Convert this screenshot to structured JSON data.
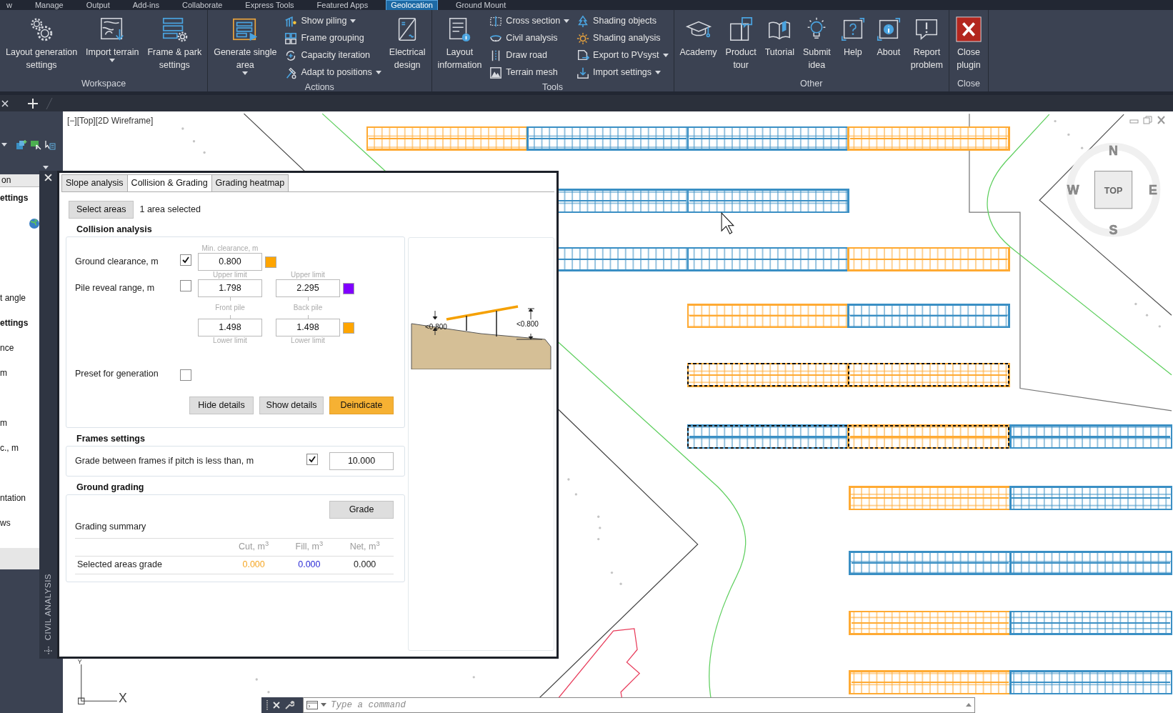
{
  "top_tabs": [
    {
      "label": "w",
      "selected": false
    },
    {
      "label": "Manage",
      "selected": false
    },
    {
      "label": "Output",
      "selected": false
    },
    {
      "label": "Add-ins",
      "selected": false
    },
    {
      "label": "Collaborate",
      "selected": false
    },
    {
      "label": "Express Tools",
      "selected": false
    },
    {
      "label": "Featured Apps",
      "selected": false
    },
    {
      "label": "Geolocation",
      "selected": true
    },
    {
      "label": "Ground Mount",
      "selected": false
    }
  ],
  "ribbon": {
    "panels": [
      {
        "title": "Workspace",
        "items": [
          {
            "kind": "large",
            "label": "Layout generation\nsettings",
            "dropdown": false
          },
          {
            "kind": "large",
            "label": "Import terrain",
            "dropdown": true
          },
          {
            "kind": "large",
            "label": "Frame & park\nsettings",
            "dropdown": false
          }
        ]
      },
      {
        "title": "Actions",
        "items": [
          {
            "kind": "large",
            "label": "Generate single\narea",
            "dropdown": true
          },
          {
            "kind": "stack",
            "entries": [
              {
                "label": "Show piling",
                "dropdown": true
              },
              {
                "label": "Frame grouping",
                "dropdown": false
              },
              {
                "label": "Capacity iteration",
                "dropdown": false
              },
              {
                "label": "Adapt to positions",
                "dropdown": true
              }
            ]
          },
          {
            "kind": "large",
            "label": "Electrical\ndesign",
            "dropdown": false
          }
        ]
      },
      {
        "title": "Tools",
        "items": [
          {
            "kind": "large",
            "label": "Layout\ninformation",
            "dropdown": false
          },
          {
            "kind": "stack",
            "entries": [
              {
                "label": "Cross section",
                "dropdown": true
              },
              {
                "label": "Civil analysis",
                "dropdown": false
              },
              {
                "label": "Draw road",
                "dropdown": false
              },
              {
                "label": "Terrain mesh",
                "dropdown": false
              }
            ]
          },
          {
            "kind": "stack",
            "entries": [
              {
                "label": "Shading objects",
                "dropdown": false
              },
              {
                "label": "Shading analysis",
                "dropdown": false
              },
              {
                "label": "Export to PVsyst",
                "dropdown": true
              },
              {
                "label": "Import settings",
                "dropdown": true
              }
            ]
          }
        ]
      },
      {
        "title": "Other",
        "items": [
          {
            "kind": "large",
            "label": "Academy",
            "dropdown": false
          },
          {
            "kind": "large",
            "label": "Product\ntour",
            "dropdown": false
          },
          {
            "kind": "large",
            "label": "Tutorial",
            "dropdown": false
          },
          {
            "kind": "large",
            "label": "Submit\nidea",
            "dropdown": false
          },
          {
            "kind": "large",
            "label": "Help",
            "dropdown": false
          },
          {
            "kind": "large",
            "label": "About",
            "dropdown": false
          },
          {
            "kind": "large",
            "label": "Report\nproblem",
            "dropdown": false
          }
        ]
      },
      {
        "title": "Close",
        "items": [
          {
            "kind": "large",
            "label": "Close\nplugin",
            "dropdown": false
          }
        ]
      }
    ]
  },
  "properties_palette": {
    "header": "on",
    "rows": [
      {
        "kind": "heading",
        "text": "ettings"
      },
      {
        "kind": "icon"
      },
      {
        "kind": "item",
        "text": "t angle"
      },
      {
        "kind": "heading",
        "text": "ettings"
      },
      {
        "kind": "item",
        "text": "nce"
      },
      {
        "kind": "item",
        "text": "m"
      },
      {
        "kind": "item",
        "text": "m"
      },
      {
        "kind": "item",
        "text": "c., m"
      },
      {
        "kind": "item",
        "text": "ntation"
      },
      {
        "kind": "item",
        "text": "ws"
      }
    ]
  },
  "civil_analysis": {
    "title": "CIVIL ANALYSIS",
    "tabs": [
      {
        "label": "Slope analysis",
        "selected": false
      },
      {
        "label": "Collision & Grading",
        "selected": true
      },
      {
        "label": "Grading heatmap",
        "selected": false
      }
    ],
    "select_button": "Select areas",
    "selection_status": "1 area selected",
    "collision": {
      "title": "Collision analysis",
      "ground_clearance": {
        "label": "Ground clearance, m",
        "checked": true,
        "caption": "Min. clearance, m",
        "value": "0.800",
        "color": "#ffa500"
      },
      "pile_reveal": {
        "label": "Pile reveal range, m",
        "checked": false,
        "upper_captions": [
          "Upper limit",
          "Upper limit"
        ],
        "upper_values": [
          "1.798",
          "2.295"
        ],
        "upper_swatch": {
          "color": "#8000ff"
        },
        "pile_captions": [
          "Front pile",
          "Back pile"
        ],
        "lower_values": [
          "1.498",
          "1.498"
        ],
        "lower_swatch": {
          "color": "#ffa500"
        },
        "lower_captions": [
          "Lower limit",
          "Lower limit"
        ]
      },
      "preset": {
        "label": "Preset for generation",
        "checked": false
      },
      "buttons": [
        {
          "label": "Hide details",
          "kind": "plain"
        },
        {
          "label": "Show details",
          "kind": "plain"
        },
        {
          "label": "Deindicate",
          "kind": "accent"
        }
      ]
    },
    "diagram": {
      "labels": [
        "<0.800",
        "<0.800"
      ]
    },
    "frames": {
      "title": "Frames settings",
      "label": "Grade between frames if pitch is less than, m",
      "checked": true,
      "value": "10.000"
    },
    "grading": {
      "title": "Ground grading",
      "button": "Grade",
      "summary_title": "Grading summary",
      "columns": [
        "Cut, m$^{3}$",
        "Fill, m$^{3}$",
        "Net, m$^{3}$"
      ],
      "rows": [
        {
          "label": "Selected areas grade",
          "values": [
            {
              "text": "0.000",
              "color": "#f5a623"
            },
            {
              "text": "0.000",
              "color": "#2b2bd6"
            },
            {
              "text": "0.000",
              "color": "#222222"
            }
          ]
        }
      ]
    }
  },
  "viewport": {
    "label": "[−][Top][2D Wireframe]"
  },
  "viewcube": {
    "north": "N",
    "south": "S",
    "east": "E",
    "west": "W",
    "top": "TOP"
  },
  "ucs": {
    "x": "X",
    "y": "Y"
  },
  "command_line": {
    "placeholder": "Type a command"
  },
  "site_plan": {
    "arrays": [
      {
        "color": "#ffaa33",
        "highlighted": false
      },
      {
        "color": "#3a8fc4",
        "highlighted": false
      },
      {
        "color": "#3a8fc4",
        "highlighted": false
      },
      {
        "color": "#ffaa33",
        "highlighted": false
      },
      {
        "color": "#3a8fc4",
        "highlighted": false
      },
      {
        "color": "#3a8fc4",
        "highlighted": false
      },
      {
        "color": "#3a8fc4",
        "highlighted": false
      },
      {
        "color": "#3a8fc4",
        "highlighted": false
      },
      {
        "color": "#ffaa33",
        "highlighted": false
      },
      {
        "color": "#ffaa33",
        "highlighted": false
      },
      {
        "color": "#3a8fc4",
        "highlighted": false
      },
      {
        "color": "#ffaa33",
        "highlighted": true
      },
      {
        "color": "#ffaa33",
        "highlighted": true
      },
      {
        "color": "#3a8fc4",
        "highlighted": true
      },
      {
        "color": "#ffaa33",
        "highlighted": true
      },
      {
        "color": "#3a8fc4",
        "highlighted": false
      },
      {
        "color": "#ffaa33",
        "highlighted": false
      },
      {
        "color": "#3a8fc4",
        "highlighted": false
      },
      {
        "color": "#3a8fc4",
        "highlighted": false
      },
      {
        "color": "#3a8fc4",
        "highlighted": false
      },
      {
        "color": "#ffaa33",
        "highlighted": false
      },
      {
        "color": "#3a8fc4",
        "highlighted": false
      },
      {
        "color": "#ffaa33",
        "highlighted": false
      },
      {
        "color": "#3a8fc4",
        "highlighted": false
      }
    ]
  }
}
